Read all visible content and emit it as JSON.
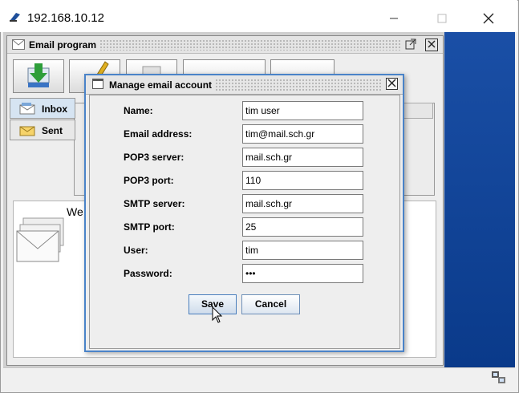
{
  "window": {
    "title": "192.168.10.12"
  },
  "email_program": {
    "title": "Email program"
  },
  "folders": [
    {
      "label": "Inbox"
    },
    {
      "label": "Sent"
    }
  ],
  "welcome": {
    "text": "We"
  },
  "dialog": {
    "title": "Manage email account",
    "fields": [
      {
        "label": "Name:",
        "value": "tim user"
      },
      {
        "label": "Email address:",
        "value": "tim@mail.sch.gr"
      },
      {
        "label": "POP3 server:",
        "value": "mail.sch.gr"
      },
      {
        "label": "POP3 port:",
        "value": "110"
      },
      {
        "label": "SMTP server:",
        "value": "mail.sch.gr"
      },
      {
        "label": "SMTP port:",
        "value": "25"
      },
      {
        "label": "User:",
        "value": "tim"
      },
      {
        "label": "Password:",
        "value": "•••"
      }
    ],
    "save_label": "Save",
    "cancel_label": "Cancel"
  },
  "colors": {
    "dialog_border": "#4a83c8",
    "desktop_blue": "#0a3a8a"
  }
}
